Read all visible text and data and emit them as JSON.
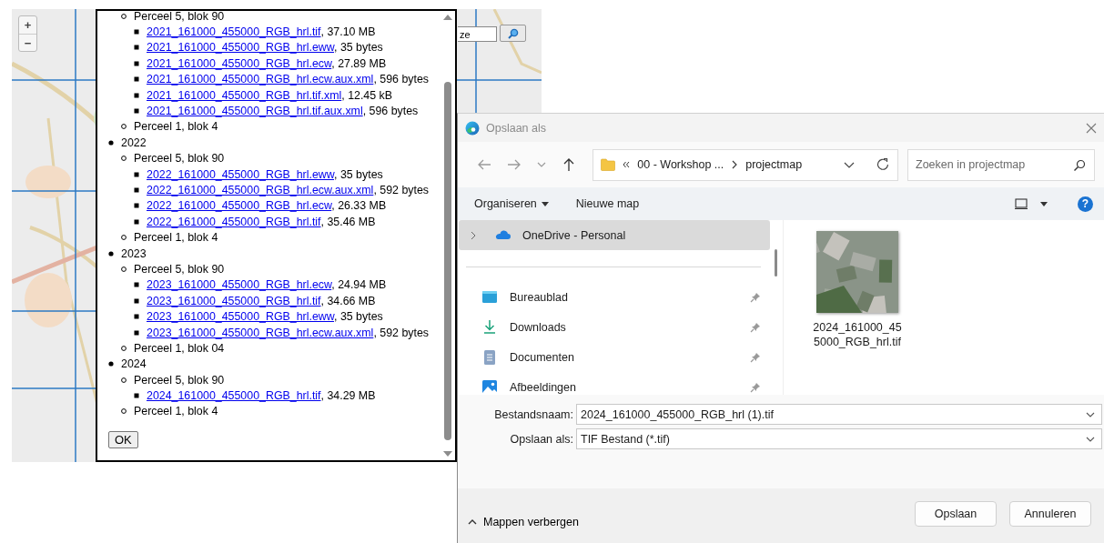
{
  "map": {
    "zoom_in": "+",
    "zoom_out": "−",
    "search": {
      "value": "ze"
    }
  },
  "file_list": {
    "tree": [
      {
        "children": [
          {
            "label": "Perceel 5, blok 90",
            "children": [
              {
                "link": "2021_161000_455000_RGB_hrl.tif",
                "rest": ", 37.10 MB"
              },
              {
                "link": "2021_161000_455000_RGB_hrl.eww",
                "rest": ", 35 bytes"
              },
              {
                "link": "2021_161000_455000_RGB_hrl.ecw",
                "rest": ", 27.89 MB"
              },
              {
                "link": "2021_161000_455000_RGB_hrl.ecw.aux.xml",
                "rest": ", 596 bytes"
              },
              {
                "link": "2021_161000_455000_RGB_hrl.tif.xml",
                "rest": ", 12.45 kB"
              },
              {
                "link": "2021_161000_455000_RGB_hrl.tif.aux.xml",
                "rest": ", 596 bytes"
              }
            ]
          },
          {
            "label": "Perceel 1, blok 4"
          }
        ]
      },
      {
        "label": "2022",
        "children": [
          {
            "label": "Perceel 5, blok 90",
            "children": [
              {
                "link": "2022_161000_455000_RGB_hrl.eww",
                "rest": ", 35 bytes"
              },
              {
                "link": "2022_161000_455000_RGB_hrl.ecw.aux.xml",
                "rest": ", 592 bytes"
              },
              {
                "link": "2022_161000_455000_RGB_hrl.ecw",
                "rest": ", 26.33 MB"
              },
              {
                "link": "2022_161000_455000_RGB_hrl.tif",
                "rest": ", 35.46 MB"
              }
            ]
          },
          {
            "label": "Perceel 1, blok 4"
          }
        ]
      },
      {
        "label": "2023",
        "children": [
          {
            "label": "Perceel 5, blok 90",
            "children": [
              {
                "link": "2023_161000_455000_RGB_hrl.ecw",
                "rest": ", 24.94 MB"
              },
              {
                "link": "2023_161000_455000_RGB_hrl.tif",
                "rest": ", 34.66 MB"
              },
              {
                "link": "2023_161000_455000_RGB_hrl.eww",
                "rest": ", 35 bytes"
              },
              {
                "link": "2023_161000_455000_RGB_hrl.ecw.aux.xml",
                "rest": ", 592 bytes"
              }
            ]
          },
          {
            "label": "Perceel 1, blok 04"
          }
        ]
      },
      {
        "label": "2024",
        "children": [
          {
            "label": "Perceel 5, blok 90",
            "children": [
              {
                "link": "2024_161000_455000_RGB_hrl.tif",
                "rest": ", 34.29 MB"
              }
            ]
          },
          {
            "label": "Perceel 1, blok 4"
          }
        ]
      }
    ],
    "ok_button": "OK"
  },
  "save_dialog": {
    "title": "Opslaan als",
    "address": {
      "path": [
        "00 - Workshop ...",
        "projectmap"
      ]
    },
    "search": {
      "placeholder": "Zoeken in projectmap"
    },
    "toolbar": {
      "organize": "Organiseren",
      "new_folder": "Nieuwe map",
      "help": "?"
    },
    "nav": [
      {
        "label": "OneDrive - Personal",
        "kind": "cloud",
        "selected": true,
        "pinned": false,
        "expandable": true
      },
      {
        "label": "Bureaublad",
        "kind": "desktop",
        "selected": false,
        "pinned": true,
        "expandable": false
      },
      {
        "label": "Downloads",
        "kind": "download",
        "selected": false,
        "pinned": true,
        "expandable": false
      },
      {
        "label": "Documenten",
        "kind": "document",
        "selected": false,
        "pinned": true,
        "expandable": false
      },
      {
        "label": "Afbeeldingen",
        "kind": "pictures",
        "selected": false,
        "pinned": true,
        "expandable": false
      }
    ],
    "files": [
      {
        "name": "2024_161000_455000_RGB_hrl.tif",
        "kind": "picture"
      }
    ],
    "filename": {
      "label": "Bestandsnaam:",
      "value": "2024_161000_455000_RGB_hrl (1).tif"
    },
    "filetype": {
      "label": "Opslaan als:",
      "value": "TIF Bestand (*.tif)"
    },
    "hide_folders": "Mappen verbergen",
    "buttons": [
      "Opslaan",
      "Annuleren"
    ]
  }
}
